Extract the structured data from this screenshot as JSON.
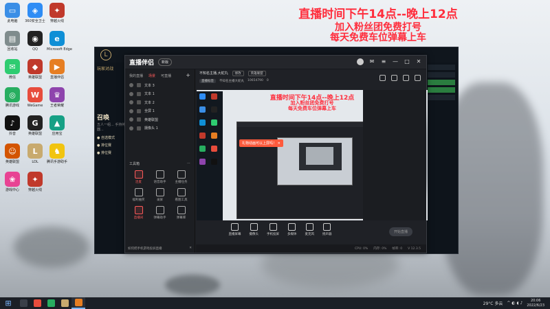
{
  "overlay": {
    "line1": "直播时间下午14点--晚上12点",
    "line2": "加入粉丝团免费打号",
    "line3": "每天免费车位弹幕上车"
  },
  "desktop_icons": [
    {
      "label": "此电脑",
      "color": "#3a8ee6",
      "glyph": "▭"
    },
    {
      "label": "360安全卫士",
      "color": "#2f8df5",
      "glyph": "◈"
    },
    {
      "label": "穿越火线",
      "color": "#c0392b",
      "glyph": "✦"
    },
    {
      "label": "回收站",
      "color": "#7f8c8d",
      "glyph": "▤"
    },
    {
      "label": "QQ",
      "color": "#222222",
      "glyph": "◉"
    },
    {
      "label": "Microsoft Edge",
      "color": "#0f8fd6",
      "glyph": "e"
    },
    {
      "label": "微信",
      "color": "#2ecc71",
      "glyph": "✉"
    },
    {
      "label": "英雄联盟",
      "color": "#c0392b",
      "glyph": "◆"
    },
    {
      "label": "直播伴侣",
      "color": "#e67e22",
      "glyph": "▶"
    },
    {
      "label": "腾讯游戏",
      "color": "#27ae60",
      "glyph": "◎"
    },
    {
      "label": "WeGame",
      "color": "#e74c3c",
      "glyph": "W"
    },
    {
      "label": "王者荣耀",
      "color": "#8e44ad",
      "glyph": "♛"
    },
    {
      "label": "抖音",
      "color": "#111111",
      "glyph": "♪"
    },
    {
      "label": "英雄联盟",
      "color": "#222222",
      "glyph": "G"
    },
    {
      "label": "应用宝",
      "color": "#16a085",
      "glyph": "▲"
    },
    {
      "label": "英雄联盟",
      "color": "#d35400",
      "glyph": "☺"
    },
    {
      "label": "LOL",
      "color": "#c8aa6e",
      "glyph": "L"
    },
    {
      "label": "腾讯手游助手",
      "color": "#f1c40f",
      "glyph": "♞"
    },
    {
      "label": "游戏中心",
      "color": "#e84393",
      "glyph": "❀"
    },
    {
      "label": "穿越火线",
      "color": "#c0392b",
      "glyph": "✦"
    }
  ],
  "lol_client": {
    "left_title": "玩家对战",
    "left_heading": "召唤",
    "left_desc": "五人一组... 手持神器...",
    "list": [
      "● 自选模式",
      "● 排位赛",
      "● 排位赛"
    ]
  },
  "app": {
    "title": "直播伴侣",
    "badge": "新版",
    "tabs": [
      "我的直播",
      "场景",
      "可直播"
    ],
    "active_tab": "场景",
    "sources": [
      "文本 3",
      "文本 1",
      "文本 2",
      "全屏 1",
      "英雄联盟",
      "摄像头 1"
    ],
    "tools_heading": "工具箱",
    "tools": [
      {
        "label": "连麦",
        "red": true
      },
      {
        "label": "语音助手",
        "red": false
      },
      {
        "label": "主播任务",
        "red": false
      },
      {
        "label": "福利抽奖",
        "red": false
      },
      {
        "label": "录屏",
        "red": false
      },
      {
        "label": "看图工具",
        "red": false
      },
      {
        "label": "直播间",
        "red": true
      },
      {
        "label": "弹幕助手",
        "red": false
      },
      {
        "label": "弹幕库",
        "red": false
      }
    ],
    "footer_left": "如何把手机游戏投屏直播",
    "footer_right": "✕",
    "live_title": "不知名主播,大蛇丸",
    "edit_label": "修改",
    "category": "英雄联盟",
    "room_tag": "直播标签",
    "room_id_label": "不知名主播大蛇丸",
    "room_id": "10654790",
    "fans": "0",
    "preview_tip": "礼物动画可以上屏吗！ ✕",
    "bottom_tools": [
      "直播屏幕",
      "摄像头",
      "手机投屏",
      "多媒体",
      "麦克风",
      "扬声器"
    ],
    "start_button": "开始直播",
    "status": [
      "CPU: 0%",
      "内存: 0%",
      "帧率: 0"
    ],
    "version": "V 12.3.5"
  },
  "taskbar": {
    "weather": "29°C 多云",
    "time": "20:06",
    "date": "2022/6/23"
  }
}
